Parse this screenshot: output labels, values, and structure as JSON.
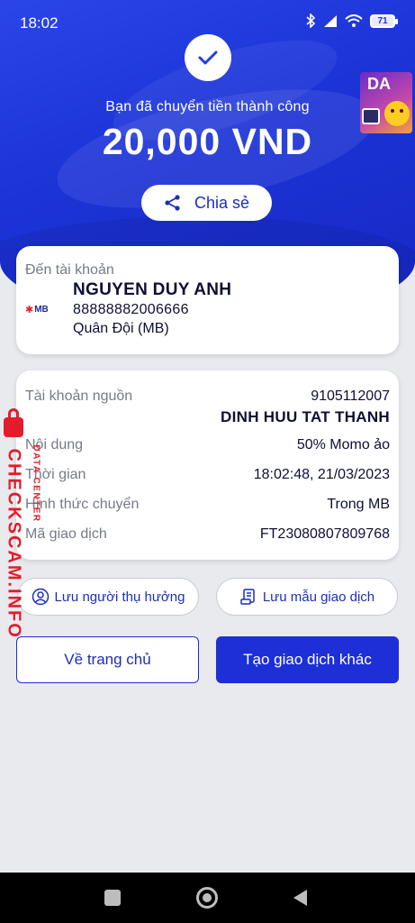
{
  "status_bar": {
    "time": "18:02",
    "battery": "71"
  },
  "header": {
    "success_text": "Bạn đã chuyển tiền thành công",
    "amount": "20,000 VND",
    "share_label": "Chia sẻ",
    "promo_title": "DA"
  },
  "recipient": {
    "label": "Đến tài khoản",
    "bank_logo": "MB",
    "name": "NGUYEN DUY ANH",
    "account": "88888882006666",
    "bank": "Quân Đội (MB)"
  },
  "details": {
    "source_label": "Tài khoản nguồn",
    "source_account": "9105112007",
    "source_name": "DINH HUU TAT THANH",
    "content_label": "Nội dung",
    "content_value": "50% Momo ảo",
    "time_label": "Thời gian",
    "time_value": "18:02:48, 21/03/2023",
    "method_label": "Hình thức chuyển",
    "method_value": "Trong MB",
    "txn_label": "Mã giao dịch",
    "txn_value": "FT23080807809768"
  },
  "actions": {
    "save_recipient": "Lưu người thụ hưởng",
    "save_template": "Lưu mẫu giao dịch",
    "home": "Về trang chủ",
    "new_transaction": "Tạo giao dịch khác"
  },
  "watermark": {
    "site": "CHECKSCAM.INFO",
    "tag": "DATA CENTER"
  },
  "icons": [
    "check-icon",
    "share-icon",
    "user-icon",
    "document-icon",
    "bluetooth-icon",
    "signal-icon",
    "wifi-icon",
    "battery-icon",
    "lock-icon"
  ],
  "colors": {
    "primary": "#1d2fd6",
    "header_bg": "#1c33d6",
    "watermark": "#e21d2b"
  }
}
